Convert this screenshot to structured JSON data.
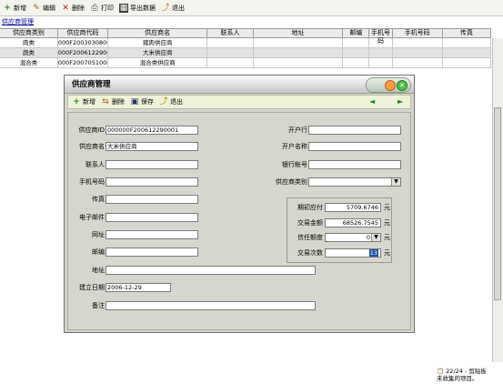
{
  "toolbar": {
    "new_label": "新增",
    "edit_label": "编辑",
    "delete_label": "删除",
    "print_label": "打印",
    "export_label": "导出数据",
    "exit_label": "退出"
  },
  "tab": {
    "label": "供应商管理"
  },
  "grid": {
    "columns": [
      "供应商类别",
      "供应商代码",
      "供应商名",
      "联系人",
      "地址",
      "邮编",
      "手机号码",
      "传真"
    ],
    "rows": [
      [
        "肉类",
        "000F2003030800",
        "猪肉供应商",
        "",
        "",
        "",
        "",
        ""
      ],
      [
        "蔬类",
        "000F2006122900",
        "大米供应商",
        "",
        "",
        "",
        "",
        ""
      ],
      [
        "混合类",
        "000F2007051000",
        "混合类供应商",
        "",
        "",
        "",
        "",
        ""
      ]
    ]
  },
  "statusbar": {
    "clipboard_count": "22/24 - 剪贴板",
    "uncollected": "未收集的项目。"
  },
  "dialog": {
    "title": "供应商管理",
    "toolbar": {
      "new_label": "新增",
      "delete_label": "删除",
      "save_label": "保存",
      "exit_label": "退出",
      "prev_icon": "◄",
      "next_icon": "►"
    },
    "form": {
      "supplier_id_label": "供应商ID",
      "supplier_id_value": "000000F200612290001",
      "supplier_name_label": "供应商名",
      "supplier_name_value": "大米供应商",
      "contact_label": "联系人",
      "contact_value": "",
      "mobile_label": "手机号码",
      "mobile_value": "",
      "fax_label": "传真",
      "fax_value": "",
      "email_label": "电子邮件",
      "email_value": "",
      "website_label": "网址",
      "website_value": "",
      "postcode_label": "邮编",
      "postcode_value": "",
      "address_label": "地址",
      "address_value": "",
      "created_date_label": "建立日期",
      "created_date_value": "2006-12-29",
      "remark_label": "备注",
      "remark_value": "",
      "bank_label": "开户行",
      "bank_value": "",
      "account_name_label": "开户名称",
      "account_name_value": "",
      "bank_account_label": "银行帐号",
      "bank_account_value": "",
      "category_label": "供应商类别",
      "category_value": "",
      "opening_payable_label": "期初应付",
      "opening_payable_value": "5709.6746",
      "trade_amount_label": "交易金额",
      "trade_amount_value": "68526.7545",
      "credit_limit_label": "信任额度",
      "credit_limit_value": "0",
      "trade_count_label": "交易次数",
      "trade_count_value": "13",
      "unit_yuan": "元",
      "unit_times": "元"
    }
  }
}
